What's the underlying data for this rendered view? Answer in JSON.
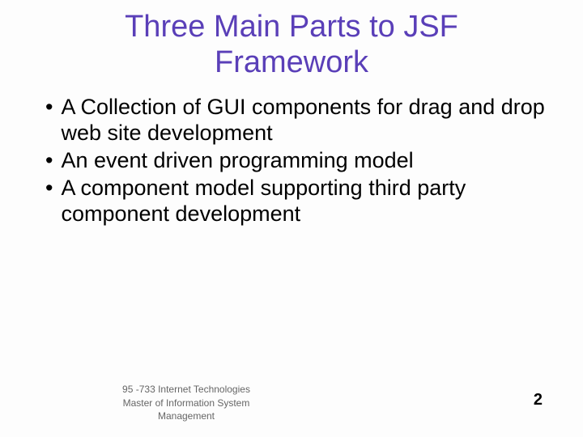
{
  "title": "Three Main Parts to JSF Framework",
  "bullets": [
    "A Collection of GUI components for drag and drop web site development",
    "An event driven programming model",
    "A component model supporting third party component development"
  ],
  "footer": {
    "line1": "95 -733 Internet Technologies",
    "line2": "Master of Information System Management"
  },
  "page_number": "2"
}
